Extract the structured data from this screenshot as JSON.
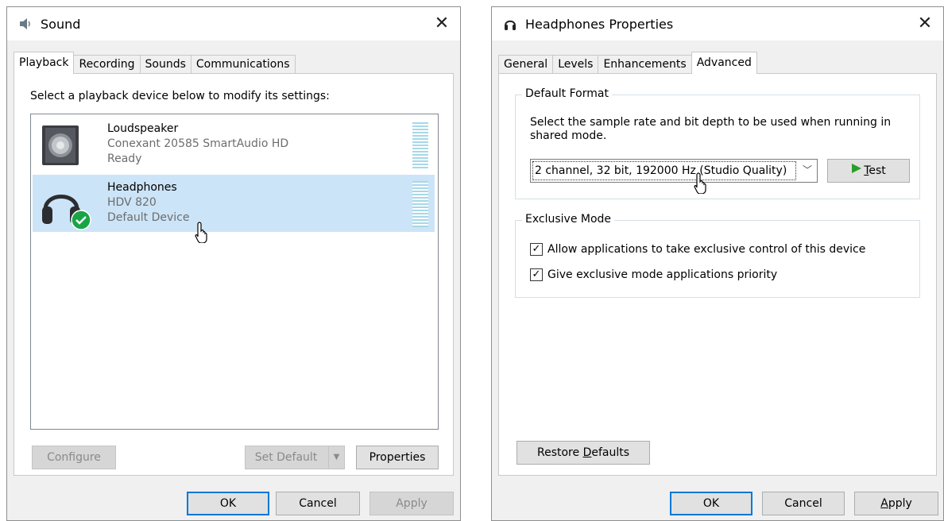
{
  "sound_window": {
    "title": "Sound",
    "icon": "speaker-icon",
    "tabs": [
      {
        "label": "Playback",
        "active": true
      },
      {
        "label": "Recording",
        "active": false
      },
      {
        "label": "Sounds",
        "active": false
      },
      {
        "label": "Communications",
        "active": false
      }
    ],
    "instruction": "Select a playback device below to modify its settings:",
    "devices": [
      {
        "name": "Loudspeaker",
        "description": "Conexant 20585 SmartAudio HD",
        "status": "Ready",
        "icon": "loudspeaker-icon",
        "selected": false
      },
      {
        "name": "Headphones",
        "description": "HDV 820",
        "status": "Default Device",
        "icon": "headphones-icon",
        "selected": true,
        "badge": "default-check-icon"
      }
    ],
    "buttons": {
      "configure": "Configure",
      "set_default": "Set Default",
      "properties": "Properties",
      "ok": "OK",
      "cancel": "Cancel",
      "apply": "Apply"
    }
  },
  "properties_window": {
    "title": "Headphones Properties",
    "icon": "headphones-icon",
    "tabs": [
      {
        "label": "General",
        "active": false
      },
      {
        "label": "Levels",
        "active": false
      },
      {
        "label": "Enhancements",
        "active": false
      },
      {
        "label": "Advanced",
        "active": true
      }
    ],
    "default_format": {
      "label": "Default Format",
      "description": "Select the sample rate and bit depth to be used when running in shared mode.",
      "selected_format": "2 channel, 32 bit, 192000 Hz (Studio Quality)",
      "test_button_prefix": "",
      "test_button_underlined": "T",
      "test_button_rest": "est"
    },
    "exclusive_mode": {
      "label": "Exclusive Mode",
      "options": [
        {
          "label": "Allow applications to take exclusive control of this device",
          "checked": true
        },
        {
          "label": "Give exclusive mode applications priority",
          "checked": true
        }
      ]
    },
    "buttons": {
      "restore_prefix": "Restore ",
      "restore_underlined": "D",
      "restore_rest": "efaults",
      "ok": "OK",
      "cancel": "Cancel",
      "apply_underlined": "A",
      "apply_rest": "pply"
    }
  },
  "colors": {
    "selection": "#cce4f7",
    "focus_border": "#0078d7",
    "check_badge": "#19a446",
    "test_play": "#2a9d2a",
    "meter": "#a6d8e8"
  }
}
